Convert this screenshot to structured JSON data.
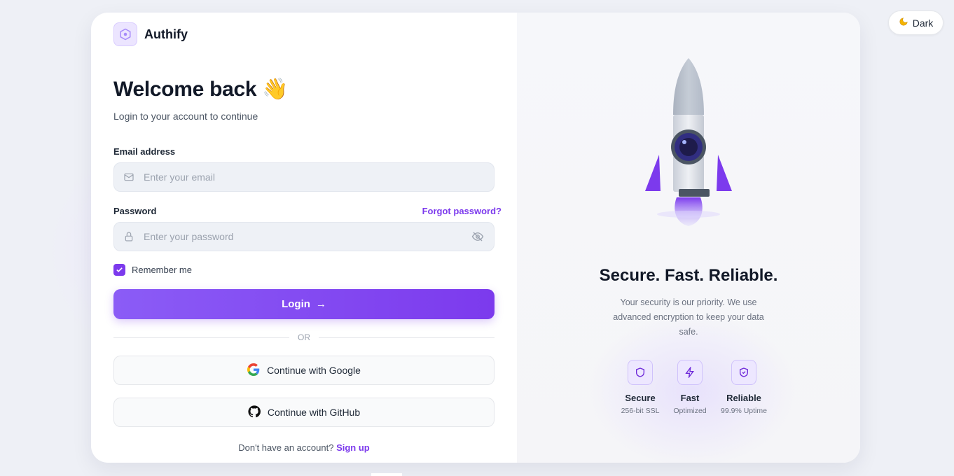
{
  "theme_toggle": {
    "icon": "moon-icon",
    "label": "Dark"
  },
  "brand": {
    "name": "Authify",
    "icon": "hexagon-logo-icon"
  },
  "login": {
    "title": "Welcome back 👋",
    "subtitle": "Login to your account to continue",
    "email": {
      "label": "Email address",
      "placeholder": "Enter your email",
      "value": ""
    },
    "password": {
      "label": "Password",
      "placeholder": "Enter your password",
      "value": "",
      "forgot_label": "Forgot password?"
    },
    "remember": {
      "label": "Remember me",
      "checked": true
    },
    "submit_label": "Login",
    "submit_arrow": "→",
    "divider_label": "OR",
    "google_label": "Continue with Google",
    "github_label": "Continue with GitHub",
    "signup_prompt": "Don't have an account?",
    "signup_link": "Sign up"
  },
  "promo": {
    "title": "Secure. Fast. Reliable.",
    "description": "Your security is our priority. We use advanced encryption to keep your data safe.",
    "features": [
      {
        "name": "Secure",
        "sub": "256-bit SSL",
        "icon": "shield-icon"
      },
      {
        "name": "Fast",
        "sub": "Optimized",
        "icon": "lightning-icon"
      },
      {
        "name": "Reliable",
        "sub": "99.9% Uptime",
        "icon": "shield-check-icon"
      }
    ]
  },
  "colors": {
    "accent": "#7c3aed",
    "accent_light": "#8b5cf6",
    "background": "#eef0f6"
  }
}
